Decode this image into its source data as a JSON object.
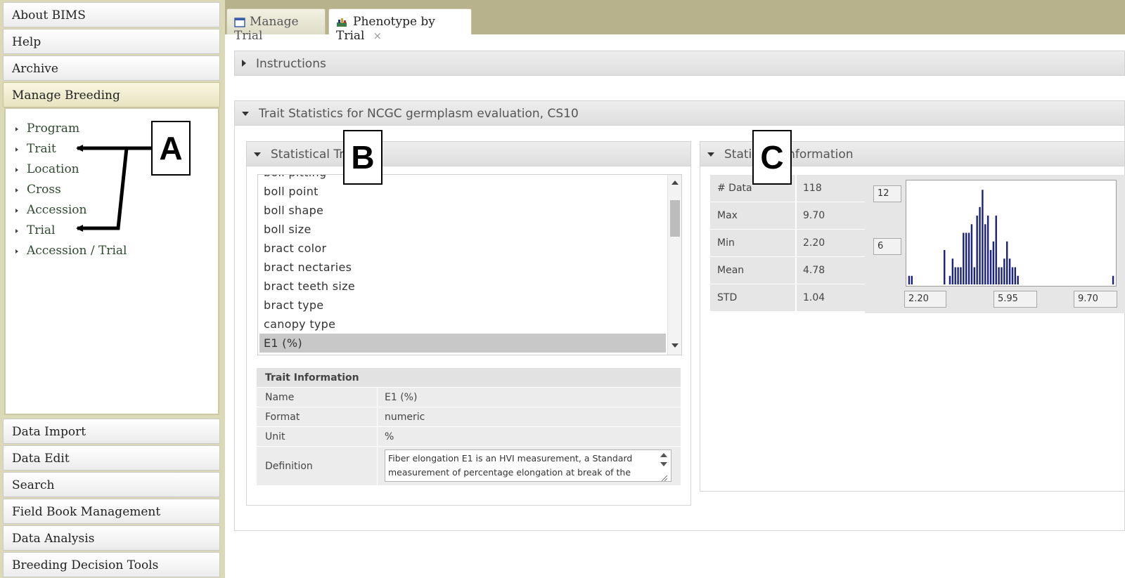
{
  "sidebar": {
    "headers_top": [
      "About BIMS",
      "Help",
      "Archive",
      "Manage Breeding"
    ],
    "manage_items": [
      "Program",
      "Trait",
      "Location",
      "Cross",
      "Accession",
      "Trial",
      "Accession / Trial"
    ],
    "headers_bottom": [
      "Data Import",
      "Data Edit",
      "Search",
      "Field Book Management",
      "Data Analysis",
      "Breeding Decision Tools"
    ]
  },
  "tabs": [
    {
      "label": "Manage Trial"
    },
    {
      "label": "Phenotype by Trial",
      "close": "×"
    }
  ],
  "instructions_label": "Instructions",
  "trait_stats_title": "Trait Statistics for NCGC germplasm evaluation, CS10",
  "statistical_trait": {
    "header": "Statistical Tra",
    "list": [
      "boll pitting",
      "boll point",
      "boll shape",
      "boll size",
      "bract color",
      "bract nectaries",
      "bract teeth size",
      "bract type",
      "canopy type",
      "E1 (%)"
    ],
    "selected": "E1 (%)"
  },
  "trait_info": {
    "header": "Trait Information",
    "rows": [
      {
        "label": "Name",
        "value": "E1 (%)"
      },
      {
        "label": "Format",
        "value": "numeric"
      },
      {
        "label": "Unit",
        "value": "%"
      }
    ],
    "definition_label": "Definition",
    "definition": "Fiber elongation E1 is an HVI measurement, a Standard measurement of percentage elongation at break of the"
  },
  "statistical_info": {
    "header_left": "Statis",
    "header_right": "nformation",
    "rows": [
      {
        "label": "# Data",
        "value": "118"
      },
      {
        "label": "Max",
        "value": "9.70"
      },
      {
        "label": "Min",
        "value": "2.20"
      },
      {
        "label": "Mean",
        "value": "4.78"
      },
      {
        "label": "STD",
        "value": "1.04"
      }
    ],
    "y_ticks": [
      "12",
      "6"
    ],
    "x_ticks": [
      "2.20",
      "5.95",
      "9.70"
    ]
  },
  "chart_data": {
    "type": "bar",
    "title": "",
    "xlabel": "",
    "ylabel": "",
    "xlim": [
      2.2,
      9.7
    ],
    "ylim": [
      0,
      12
    ],
    "bar_color": "#1a237e",
    "categories": [
      2.2,
      2.3,
      2.4,
      2.5,
      2.6,
      2.7,
      2.8,
      2.9,
      3.0,
      3.1,
      3.2,
      3.3,
      3.4,
      3.5,
      3.6,
      3.7,
      3.8,
      3.9,
      4.0,
      4.1,
      4.2,
      4.3,
      4.4,
      4.5,
      4.6,
      4.7,
      4.8,
      4.9,
      5.0,
      5.1,
      5.2,
      5.3,
      5.4,
      5.5,
      5.6,
      5.7,
      5.8,
      5.9,
      6.0,
      6.1,
      6.2,
      6.3,
      6.4,
      6.5,
      6.6,
      6.7,
      6.8,
      6.9,
      7.0,
      7.1,
      7.2,
      7.3,
      7.4,
      7.5,
      7.6,
      7.7,
      7.8,
      7.9,
      8.0,
      8.1,
      8.2,
      8.3,
      8.4,
      8.5,
      8.6,
      8.7,
      8.8,
      8.9,
      9.0,
      9.1,
      9.2,
      9.3,
      9.4,
      9.5,
      9.6,
      9.7
    ],
    "values": [
      1,
      1,
      0,
      0,
      0,
      0,
      0,
      0,
      0,
      0,
      0,
      0,
      0,
      4,
      0,
      1,
      3,
      2,
      2,
      2,
      6,
      6,
      6,
      7,
      2,
      8,
      9,
      11,
      7,
      8,
      4,
      5,
      8,
      2,
      2,
      3,
      5,
      3,
      2,
      2,
      1,
      0,
      0,
      0,
      0,
      0,
      0,
      0,
      0,
      0,
      0,
      0,
      0,
      0,
      0,
      0,
      0,
      0,
      0,
      0,
      0,
      0,
      0,
      0,
      0,
      0,
      0,
      0,
      0,
      0,
      0,
      0,
      0,
      0,
      0,
      1
    ]
  },
  "callouts": [
    "A",
    "B",
    "C"
  ]
}
